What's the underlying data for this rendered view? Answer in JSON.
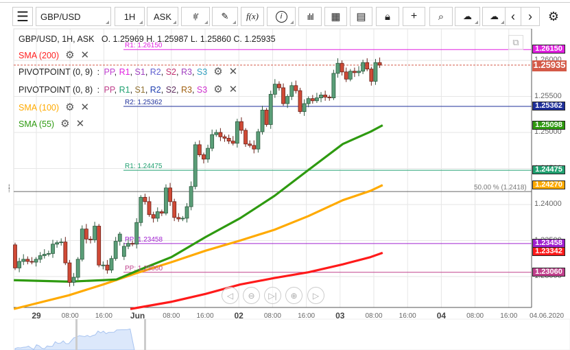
{
  "toolbar": {
    "menu_icon": "hamburger-icon",
    "symbol": "GBP/USD",
    "timeframe": "1H",
    "price_type": "ASK",
    "tools": [
      "candlestick-type-icon",
      "pencil-icon",
      "fx-icon",
      "info-icon",
      "bar-chart-icon",
      "calendar-icon",
      "report-icon",
      "lock-icon",
      "crosshair-icon",
      "zoom-icon",
      "cloud-upload-icon",
      "cloud-download-icon",
      "chevron-left-icon",
      "chevron-right-icon",
      "gear-icon"
    ],
    "fx_label": "f(x)"
  },
  "legend": {
    "header": "GBP/USD, 1H, ASK   O. 1.25969 H. 1.25987 L. 1.25860 C. 1.25935",
    "sma200": "SMA (200)",
    "pivot9": {
      "label": "PIVOTPOINT (0, 9)",
      "sep": " : ",
      "items": [
        {
          "t": "PP",
          "c": "#c040d0"
        },
        {
          "t": "R1",
          "c": "#e020e0"
        },
        {
          "t": "S1",
          "c": "#a040c0"
        },
        {
          "t": "R2",
          "c": "#6060d0"
        },
        {
          "t": "S2",
          "c": "#c03070"
        },
        {
          "t": "R3",
          "c": "#a040c0"
        },
        {
          "t": "S3",
          "c": "#30a0c0"
        }
      ]
    },
    "pivot8": {
      "label": "PIVOTPOINT (0, 8)",
      "sep": " : ",
      "items": [
        {
          "t": "PP",
          "c": "#c0408c"
        },
        {
          "t": "R1",
          "c": "#20a070"
        },
        {
          "t": "S1",
          "c": "#907030"
        },
        {
          "t": "R2",
          "c": "#2040b0"
        },
        {
          "t": "S2",
          "c": "#603060"
        },
        {
          "t": "R3",
          "c": "#a06010"
        },
        {
          "t": "S3",
          "c": "#d030d0"
        }
      ]
    },
    "sma100": "SMA (100)",
    "sma55": "SMA (55)"
  },
  "colors": {
    "up": "#5a9e78",
    "down": "#d04a36",
    "sma200": "#ff1a1a",
    "sma100": "#ffaa00",
    "sma55": "#2e9a10"
  },
  "levels": [
    {
      "label": "R1: 1.26150",
      "price": 1.2615,
      "tag": "1.26150",
      "color": "#e020e0",
      "from_legend": true
    },
    {
      "label": "R2: 1.25362",
      "price": 1.25362,
      "tag": "1.25362",
      "color": "#1e2f9a",
      "from_legend": true
    },
    {
      "label": "R1: 1.24475",
      "price": 1.24475,
      "tag": "1.24475",
      "color": "#20a070",
      "from_legend": true
    },
    {
      "label": "PP: 1.23458",
      "price": 1.23458,
      "tag": "1.23458",
      "color": "#a020d0",
      "from_legend": true
    },
    {
      "label": "PP: 1.23060",
      "price": 1.2306,
      "tag": "1.23060",
      "color": "#c0408c",
      "from_legend": true
    }
  ],
  "current": {
    "price": 1.25935,
    "tag": "1.25935",
    "color": "#d45a48"
  },
  "fib": {
    "label": "50.00 % (1.2418)",
    "price": 1.2418
  },
  "sma_tags": [
    {
      "tag": "1.25098",
      "price": 1.25098,
      "color": "#2e9a10"
    },
    {
      "tag": "1.24270",
      "price": 1.2427,
      "color": "#ffaa00"
    },
    {
      "tag": "1.23342",
      "price": 1.23342,
      "color": "#ff1a1a"
    }
  ],
  "chart_data": {
    "type": "candlestick",
    "interval": "1H",
    "yticks": [
      "1.26000",
      "1.25500",
      "1.25000",
      "1.24500",
      "1.24000",
      "1.23500",
      "1.23000"
    ],
    "ytick_values": [
      1.26,
      1.255,
      1.25,
      1.245,
      1.24,
      1.235,
      1.23
    ],
    "xticks": [
      {
        "t": "29",
        "h": 0,
        "b": true
      },
      {
        "t": "08:00",
        "h": 8
      },
      {
        "t": "16:00",
        "h": 16
      },
      {
        "t": "Jun",
        "h": 24,
        "b": true
      },
      {
        "t": "08:00",
        "h": 32
      },
      {
        "t": "16:00",
        "h": 40
      },
      {
        "t": "02",
        "h": 48,
        "b": true
      },
      {
        "t": "08:00",
        "h": 56
      },
      {
        "t": "16:00",
        "h": 64
      },
      {
        "t": "03",
        "h": 72,
        "b": true
      },
      {
        "t": "08:00",
        "h": 80
      },
      {
        "t": "16:00",
        "h": 88
      },
      {
        "t": "04",
        "h": 96,
        "b": true
      },
      {
        "t": "08:00",
        "h": 104
      },
      {
        "t": "16:00",
        "h": 112
      }
    ],
    "date_label": "04.06.2020",
    "candles_oc": [
      [
        1.2344,
        1.2312
      ],
      [
        1.2312,
        1.2321
      ],
      [
        1.2321,
        1.2324
      ],
      [
        1.2324,
        1.2321
      ],
      [
        1.2321,
        1.232
      ],
      [
        1.232,
        1.2324
      ],
      [
        1.2324,
        1.2329
      ],
      [
        1.2329,
        1.2331
      ],
      [
        1.2331,
        1.2332
      ],
      [
        1.2332,
        1.2345
      ],
      [
        1.2345,
        1.2347
      ],
      [
        1.2347,
        1.2348
      ],
      [
        1.2348,
        1.2319
      ],
      [
        1.2319,
        1.2292
      ],
      [
        1.2292,
        1.2299
      ],
      [
        1.2299,
        1.2324
      ],
      [
        1.2324,
        1.2366
      ],
      [
        1.2366,
        1.2352
      ],
      [
        1.2352,
        1.2351
      ],
      [
        1.2351,
        1.237
      ],
      [
        1.237,
        1.2316
      ],
      [
        1.2316,
        1.2316
      ],
      [
        1.2316,
        1.2309
      ],
      [
        1.2309,
        1.2325
      ],
      [
        1.2325,
        1.2349
      ],
      [
        1.2349,
        1.2359
      ],
      [
        1.2328,
        1.2342
      ],
      [
        1.2342,
        1.2346
      ],
      [
        1.2346,
        1.2345
      ],
      [
        1.2345,
        1.2375
      ],
      [
        1.2375,
        1.241
      ],
      [
        1.241,
        1.2404
      ],
      [
        1.2404,
        1.2386
      ],
      [
        1.2386,
        1.2381
      ],
      [
        1.2381,
        1.239
      ],
      [
        1.239,
        1.2388
      ],
      [
        1.2388,
        1.2423
      ],
      [
        1.2423,
        1.2404
      ],
      [
        1.2404,
        1.2382
      ],
      [
        1.2382,
        1.238
      ],
      [
        1.238,
        1.2381
      ],
      [
        1.2381,
        1.2397
      ],
      [
        1.2397,
        1.2425
      ],
      [
        1.2425,
        1.2483
      ],
      [
        1.2483,
        1.2469
      ],
      [
        1.2469,
        1.2463
      ],
      [
        1.2463,
        1.2478
      ],
      [
        1.2478,
        1.2497
      ],
      [
        1.2497,
        1.25
      ],
      [
        1.25,
        1.2494
      ],
      [
        1.2494,
        1.2492
      ],
      [
        1.2492,
        1.2488
      ],
      [
        1.2488,
        1.2485
      ],
      [
        1.2485,
        1.2515
      ],
      [
        1.2515,
        1.2503
      ],
      [
        1.2503,
        1.2484
      ],
      [
        1.2484,
        1.2482
      ],
      [
        1.2482,
        1.2477
      ],
      [
        1.2477,
        1.2501
      ],
      [
        1.2501,
        1.2531
      ],
      [
        1.2531,
        1.2511
      ],
      [
        1.2511,
        1.2553
      ],
      [
        1.2553,
        1.2567
      ],
      [
        1.2567,
        1.2562
      ],
      [
        1.2562,
        1.254
      ],
      [
        1.254,
        1.255
      ],
      [
        1.255,
        1.2565
      ],
      [
        1.2565,
        1.2558
      ],
      [
        1.2558,
        1.2529
      ],
      [
        1.2529,
        1.254
      ],
      [
        1.254,
        1.2547
      ],
      [
        1.2547,
        1.2544
      ],
      [
        1.2544,
        1.2548
      ],
      [
        1.2548,
        1.2552
      ],
      [
        1.2552,
        1.2549
      ],
      [
        1.2549,
        1.2548
      ],
      [
        1.2548,
        1.2582
      ],
      [
        1.2582,
        1.2596
      ],
      [
        1.2596,
        1.2584
      ],
      [
        1.2584,
        1.2574
      ],
      [
        1.2574,
        1.2585
      ],
      [
        1.2585,
        1.2583
      ],
      [
        1.2583,
        1.2585
      ],
      [
        1.2585,
        1.2597
      ],
      [
        1.2597,
        1.2588
      ],
      [
        1.2588,
        1.2571
      ],
      [
        1.2571,
        1.2597
      ],
      [
        1.2597,
        1.25935
      ]
    ],
    "sma55": [
      [
        -0.3,
        1.2295
      ],
      [
        12.8,
        1.2293
      ],
      [
        21,
        1.2295
      ],
      [
        24.2,
        1.2296
      ],
      [
        29.1,
        1.2308
      ],
      [
        37.3,
        1.2327
      ],
      [
        45.5,
        1.2355
      ],
      [
        53.7,
        1.2381
      ],
      [
        61.9,
        1.2412
      ],
      [
        70,
        1.2448
      ],
      [
        78.2,
        1.2484
      ],
      [
        84.8,
        1.2501
      ],
      [
        87.7,
        1.251
      ]
    ],
    "sma100": [
      [
        -0.3,
        1.2255
      ],
      [
        12.8,
        1.2274
      ],
      [
        21,
        1.2289
      ],
      [
        29.1,
        1.2305
      ],
      [
        37.3,
        1.232
      ],
      [
        45.5,
        1.2336
      ],
      [
        53.7,
        1.235
      ],
      [
        61.9,
        1.2365
      ],
      [
        70,
        1.2384
      ],
      [
        78.2,
        1.2406
      ],
      [
        84.8,
        1.2419
      ],
      [
        87.7,
        1.2427
      ]
    ],
    "sma200": [
      [
        27.5,
        1.2255
      ],
      [
        37.3,
        1.2265
      ],
      [
        45.5,
        1.2276
      ],
      [
        53.7,
        1.2289
      ],
      [
        61.9,
        1.2298
      ],
      [
        70,
        1.2306
      ],
      [
        78.2,
        1.2317
      ],
      [
        84.8,
        1.2327
      ],
      [
        87.7,
        1.2333
      ]
    ]
  },
  "navigator": {
    "buttons": [
      "scroll-left-icon",
      "zoom-out-icon",
      "scroll-end-icon",
      "zoom-in-icon",
      "scroll-right-icon"
    ]
  }
}
